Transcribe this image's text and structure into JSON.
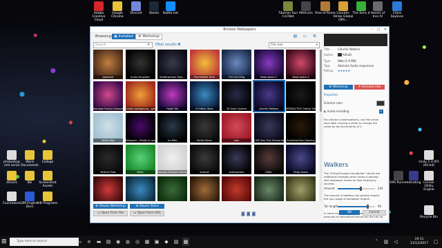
{
  "desktop_top_icons": [
    {
      "label": "Adobe Creative Cloud",
      "color": "#d4262b"
    },
    {
      "label": "Google Chrome",
      "color": "#e8c43a"
    },
    {
      "label": "Discord",
      "color": "#7289da"
    },
    {
      "label": "Steam",
      "color": "#1b2838"
    },
    {
      "label": "Battle.net",
      "color": "#148eff"
    },
    {
      "label": "Tiberian Sun CnCNet",
      "color": "#7a8a3a"
    },
    {
      "label": "MAXcom",
      "color": "#444"
    },
    {
      "label": "Rise of Rome",
      "color": "#b07a3a"
    },
    {
      "label": "Counter-Strike Global Offe...",
      "color": "#d8a03a"
    },
    {
      "label": "The Sims 4",
      "color": "#3ab03a"
    },
    {
      "label": "Hearts of Iron IV",
      "color": "#6a6a6a"
    },
    {
      "label": "Cities Skylines",
      "color": "#2a7ad8"
    }
  ],
  "desktop_left_icons": [
    {
      "label": "photoshop xml serial",
      "color": "#ddd"
    },
    {
      "label": "Word Documents",
      "color": "#e8c43a"
    },
    {
      "label": "College",
      "color": "#e8c43a"
    },
    {
      "label": "drivers",
      "color": "#e8c43a"
    },
    {
      "label": "BG",
      "color": "#e8c43a"
    },
    {
      "label": "Screenshot Assets",
      "color": "#e8c43a"
    },
    {
      "label": "Coursework",
      "color": "#ddd"
    },
    {
      "label": "DM English Docs",
      "color": "#2a5ad8"
    },
    {
      "label": "VB Programs",
      "color": "#e8c43a"
    }
  ],
  "desktop_right_icons": [
    {
      "label": "Unity 5.4.0f3 (64-bit)",
      "color": "#ddd"
    },
    {
      "label": "SMS Runner",
      "color": "#444"
    },
    {
      "label": "netrating",
      "color": "#3a3a8a"
    },
    {
      "label": "Corsair Utility Engine",
      "color": "#ddd"
    },
    {
      "label": "Recycle Bin",
      "color": "#ddd"
    }
  ],
  "window": {
    "title": "Browse Wallpapers",
    "tabs": {
      "browsing": "Browsing:",
      "installed": "Installed",
      "workshop": "Workshop"
    },
    "search_placeholder": "Search",
    "filter_results": "Filter results",
    "sort_value": "File size",
    "tiles": [
      {
        "label": "Japanese",
        "c1": "#4a2a1a",
        "c2": "#c08040"
      },
      {
        "label": "Audio Visualizer",
        "c1": "#000",
        "c2": "#333"
      },
      {
        "label": "Spiderwoman Stop...",
        "c1": "#0a0a14",
        "c2": "#3a3a4a"
      },
      {
        "label": "Psychedelic Skull",
        "c1": "#c03a3a",
        "c2": "#f0c03a"
      },
      {
        "label": "The Lich King",
        "c1": "#1a2a4a",
        "c2": "#6a8ac0"
      },
      {
        "label": "Deep space 2",
        "c1": "#1a0a3a",
        "c2": "#8a3ac0"
      },
      {
        "label": "Deep space 4",
        "c1": "#3a0a1a",
        "c2": "#d04a6a"
      },
      {
        "label": "Rainbow Fractal (Deeper)",
        "c1": "#3a0a4a",
        "c2": "#d04a8a"
      },
      {
        "label": "Orbital background - perfect loop",
        "c1": "#a02a1a",
        "c2": "#f0a03a"
      },
      {
        "label": "Hyper Me",
        "c1": "#1a0a3a",
        "c2": "#c03ac0"
      },
      {
        "label": "Gl Hither Stars",
        "c1": "#0a1a3a",
        "c2": "#3a8ac0"
      },
      {
        "label": "3D Solar System",
        "c1": "#000",
        "c2": "#2a2a4a"
      },
      {
        "label": "Colorful Walkers",
        "c1": "#0a0a2a",
        "c2": "#4a3a8a"
      },
      {
        "label": "INTERACTIVE Orbital Trails",
        "c1": "#000",
        "c2": "#1a1a1a"
      },
      {
        "label": "World Map",
        "c1": "#a0c0d0",
        "c2": "#d0e0e8"
      },
      {
        "label": "Rotagram - Ready to use Edition BETA 1.5",
        "c1": "#000",
        "c2": "#4a0a6a"
      },
      {
        "label": "Ice Web",
        "c1": "#000",
        "c2": "#2a3a4a"
      },
      {
        "label": "Radial Music",
        "c1": "#0a0a0a",
        "c2": "#3a3a3a"
      },
      {
        "label": "man",
        "c1": "#a01a2a",
        "c2": "#d04a5a"
      },
      {
        "label": "3 M2 Star Trek Enterprise",
        "c1": "#0a0a1a",
        "c2": "#3a3a5a"
      },
      {
        "label": "Animated Box Opening",
        "c1": "#000",
        "c2": "#2a1a0a"
      },
      {
        "label": "Particle Flow",
        "c1": "#0a0a0a",
        "c2": "#2a2a2a"
      },
      {
        "label": "Mesh",
        "c1": "#1a8a2a",
        "c2": "#5ad07a"
      },
      {
        "label": "Desktop Disaster Experienced",
        "c1": "#d0d0d0",
        "c2": "#f0f0f0"
      },
      {
        "label": "Arsenal",
        "c1": "#0a0a0a",
        "c2": "#3a3a3a"
      },
      {
        "label": "Audiosphere",
        "c1": "#000",
        "c2": "#3a3a5a"
      },
      {
        "label": "Hitler",
        "c1": "#0a0a0a",
        "c2": "#5a3a3a"
      },
      {
        "label": "Deep Space",
        "c1": "#0a0a2a",
        "c2": "#4a4a8a"
      },
      {
        "label": "",
        "c1": "#3a0a0a",
        "c2": "#d03a3a"
      },
      {
        "label": "",
        "c1": "#0a2a3a",
        "c2": "#3a8ac0"
      },
      {
        "label": "",
        "c1": "#0a2a0a",
        "c2": "#3a6a3a"
      },
      {
        "label": "",
        "c1": "#2a1a0a",
        "c2": "#a06a3a"
      },
      {
        "label": "",
        "c1": "#5a0a0a",
        "c2": "#c03a2a"
      },
      {
        "label": "",
        "c1": "#1a2a1a",
        "c2": "#6a8a6a"
      },
      {
        "label": "",
        "c1": "#3a3a1a",
        "c2": "#a0a06a"
      }
    ],
    "buttons": {
      "steam_workshop": "Steam Workshop",
      "steam_store": "Steam Store",
      "open_file": "Open from File",
      "open_url": "Open from URL",
      "ok": "OK",
      "cancel": "Cancel"
    },
    "side": {
      "title_k": "Title",
      "title_v": "Colorful Walkers",
      "author_k": "Author",
      "author_v": "AlfaxB",
      "type_k": "Type",
      "type_v": "Web (1.6 MB)",
      "tags_k": "Tags",
      "tags_v": "Abstract Audio responsive",
      "rating_k": "Rating",
      "rating_v": "★★★★★",
      "workshop_btn": "Workshop",
      "unsubscribe_btn": "Unsubscribe",
      "properties": "Properties",
      "scheme_color": "Scheme color",
      "audio_rec": "Audio recording",
      "audio_text": "For precise customizations, use the arrow keys after clicking a slider to change the value by de-/increments of 1.",
      "walkers_header": "Walkers",
      "walkers_text": "The \"Extra/Change minultiplier\" values are additional changes when audio is playing (the wallpaper reacts on how frequency sounds).",
      "amount_label": "Amount",
      "amount_value": "244",
      "amount_text": "The amount of walkers can greatly impact the cpu usage of wallpaper engine.",
      "tail_label": "Tail length",
      "tail_value": "90",
      "tail_text": "In some occasions (usually with high amounts of saturation/luminance) the tail (or particle) object"
    }
  },
  "taskbar": {
    "search": "Type here to search",
    "time": "19:11",
    "date": "11/12/2017"
  }
}
